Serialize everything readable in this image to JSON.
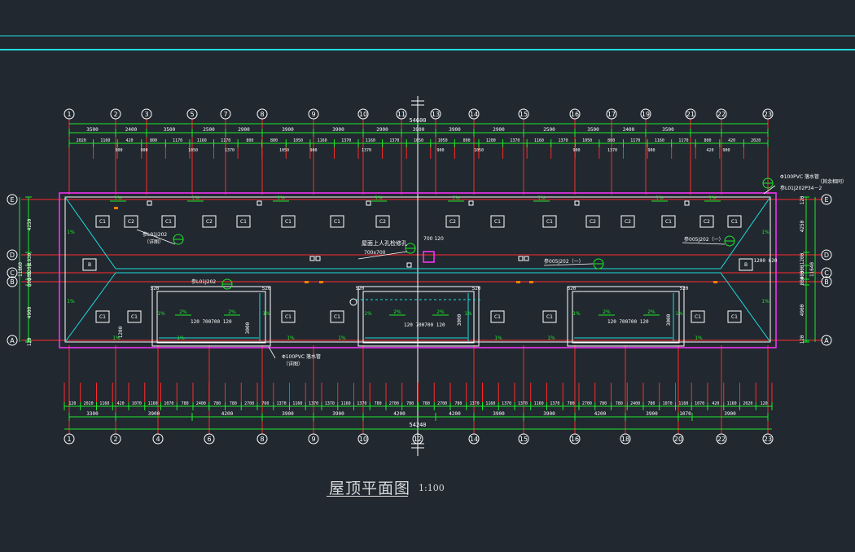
{
  "title": "屋顶平面图",
  "scale": "1:100",
  "colors": {
    "background": "#212830",
    "axis": "#ff2a2a",
    "dimension": "#1fe82a",
    "outline": "#ff33ff",
    "hip": "#1fdcdc",
    "text": "#ffffff",
    "accent": "#ff7f00",
    "title": "#d8d8d8"
  },
  "axes": {
    "top": [
      "1",
      "2",
      "3",
      "5",
      "7",
      "8",
      "9",
      "10",
      "11",
      "13",
      "14",
      "15",
      "16",
      "17",
      "19",
      "21",
      "22",
      "23"
    ],
    "bottom": [
      "1",
      "2",
      "4",
      "6",
      "8",
      "9",
      "10",
      "12",
      "14",
      "15",
      "16",
      "18",
      "20",
      "22",
      "23"
    ],
    "rows": [
      "E",
      "D",
      "C",
      "B",
      "A"
    ]
  },
  "dims": {
    "top_overall": "54600",
    "top_row1": [
      "3500",
      "2400",
      "3500",
      "2500",
      "2900",
      "3900",
      "3900",
      "2900",
      "3900",
      "3900",
      "2900",
      "2500",
      "3500",
      "2400",
      "3500"
    ],
    "top_row2": [
      "2020",
      "1160",
      "420",
      "800",
      "1170",
      "1160",
      "1170",
      "800",
      "800",
      "1050",
      "1160",
      "1370",
      "1160",
      "1370",
      "1050",
      "1050",
      "800",
      "1200",
      "1370",
      "1160",
      "1370",
      "1050",
      "800",
      "1170",
      "1160",
      "1170",
      "800",
      "420",
      "2020"
    ],
    "top_row3": [
      "900",
      "900",
      "1050",
      "1370",
      "1050",
      "900",
      "1370",
      "900",
      "1050",
      "900",
      "1370",
      "900",
      "420",
      "900"
    ],
    "bottom_row1": [
      "120",
      "2020",
      "1160",
      "420",
      "1070",
      "1160",
      "1070",
      "780",
      "2400",
      "780",
      "780",
      "2700",
      "760",
      "1370",
      "1160",
      "1370",
      "1370",
      "1160",
      "1370",
      "780",
      "2700",
      "780",
      "780",
      "2700",
      "780",
      "1370",
      "1160",
      "1370",
      "1370",
      "1160",
      "1370",
      "780",
      "2700",
      "780",
      "780",
      "2400",
      "780",
      "1070",
      "1160",
      "1070",
      "420",
      "1160",
      "2020",
      "120"
    ],
    "bottom_row2": [
      "3300",
      "3900",
      "4200",
      "3900",
      "3900",
      "4200",
      "4200",
      "3900",
      "3900",
      "4200",
      "3900",
      "1070",
      "3900"
    ],
    "bottom_overall": "54240",
    "left": [
      "4250",
      "1930",
      "1200",
      "300",
      "800",
      "4900",
      "120"
    ],
    "left_outer": [
      "11860"
    ],
    "right": [
      "120",
      "4250",
      "1200",
      "300",
      "400",
      "800",
      "4900",
      "120"
    ],
    "right_outer": [
      "11640"
    ]
  },
  "labels": {
    "c1": "C1",
    "c2": "C2",
    "b": "B",
    "slope_1": "1%",
    "slope_2": "2%",
    "hatch_title": "屋面上人孔检修孔",
    "hatch_size": "700x700",
    "hatch_dim1": "700",
    "hatch_dim2": "120",
    "note_ref1": "参L01J202",
    "note_ref1b": "（详图）",
    "note_ref2": "参005J202（一）",
    "note_ref3": "参005J202（一）",
    "note_ref4": "参L01J202",
    "pipe_top": "Φ100PVC 落水管",
    "pipe_top2": "（其余相同）",
    "pipe_top3": "参L01J202P34－2",
    "pipe_bottom": "Φ100PVC 落水管",
    "pipe_bottom2": "（详图）",
    "d520": "520",
    "d120": "120",
    "d3000": "3000",
    "d1200": "1200",
    "d700": "700",
    "d1200_620": "1200 620"
  }
}
